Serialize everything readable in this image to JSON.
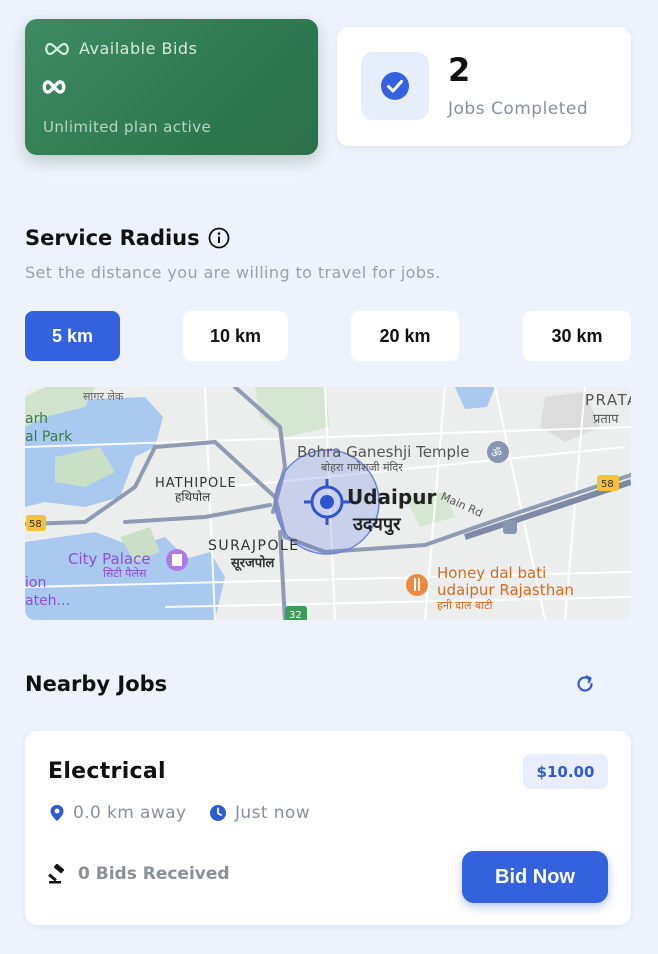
{
  "stats": {
    "bids_title": "Available Bids",
    "bids_value_icon": "infinity-icon",
    "bids_subtitle": "Unlimited plan active",
    "jobs_count": "2",
    "jobs_label": "Jobs Completed"
  },
  "service_radius": {
    "title": "Service Radius",
    "subtitle": "Set the distance you are willing to travel for jobs.",
    "options": [
      "5 km",
      "10 km",
      "20 km",
      "30 km"
    ],
    "selected": "5 km"
  },
  "map": {
    "labels": {
      "sagar_lake": "सागर लेक",
      "park_1": "arh",
      "park_2": "al Park",
      "pratap": "PRATAP",
      "pratap_hi": "प्रताप",
      "bohra": "Bohra Ganeshji Temple",
      "bohra_hi": "बोहरा गणेशजी मंदिर",
      "hathipole": "HATHIPOLE",
      "hathipole_hi": "हथिपोल",
      "udaipur": "Udaipur",
      "udaipur_hi": "उदयपुर",
      "main_rd": "Main Rd",
      "surajpole": "SURAJPOLE",
      "surajpole_hi": "सूरजपोल",
      "city_palace": "City Palace",
      "city_palace_hi": "सिटी पैलेस",
      "honey_1": "Honey dal bati",
      "honey_2": "udaipur Rajasthan",
      "honey_hi": "हनी दाल बाटी",
      "left_1": "ion",
      "left_2": "ateh...",
      "shield_58a": "58",
      "shield_58b": "58",
      "shield_32": "32"
    }
  },
  "nearby": {
    "title": "Nearby Jobs",
    "jobs": [
      {
        "title": "Electrical",
        "price": "$10.00",
        "distance": "0.0 km away",
        "time": "Just now",
        "bids": "0 Bids Received",
        "action": "Bid Now"
      }
    ]
  },
  "colors": {
    "accent": "#3461de",
    "green": "#2f7a50",
    "background": "#eef2fc"
  }
}
